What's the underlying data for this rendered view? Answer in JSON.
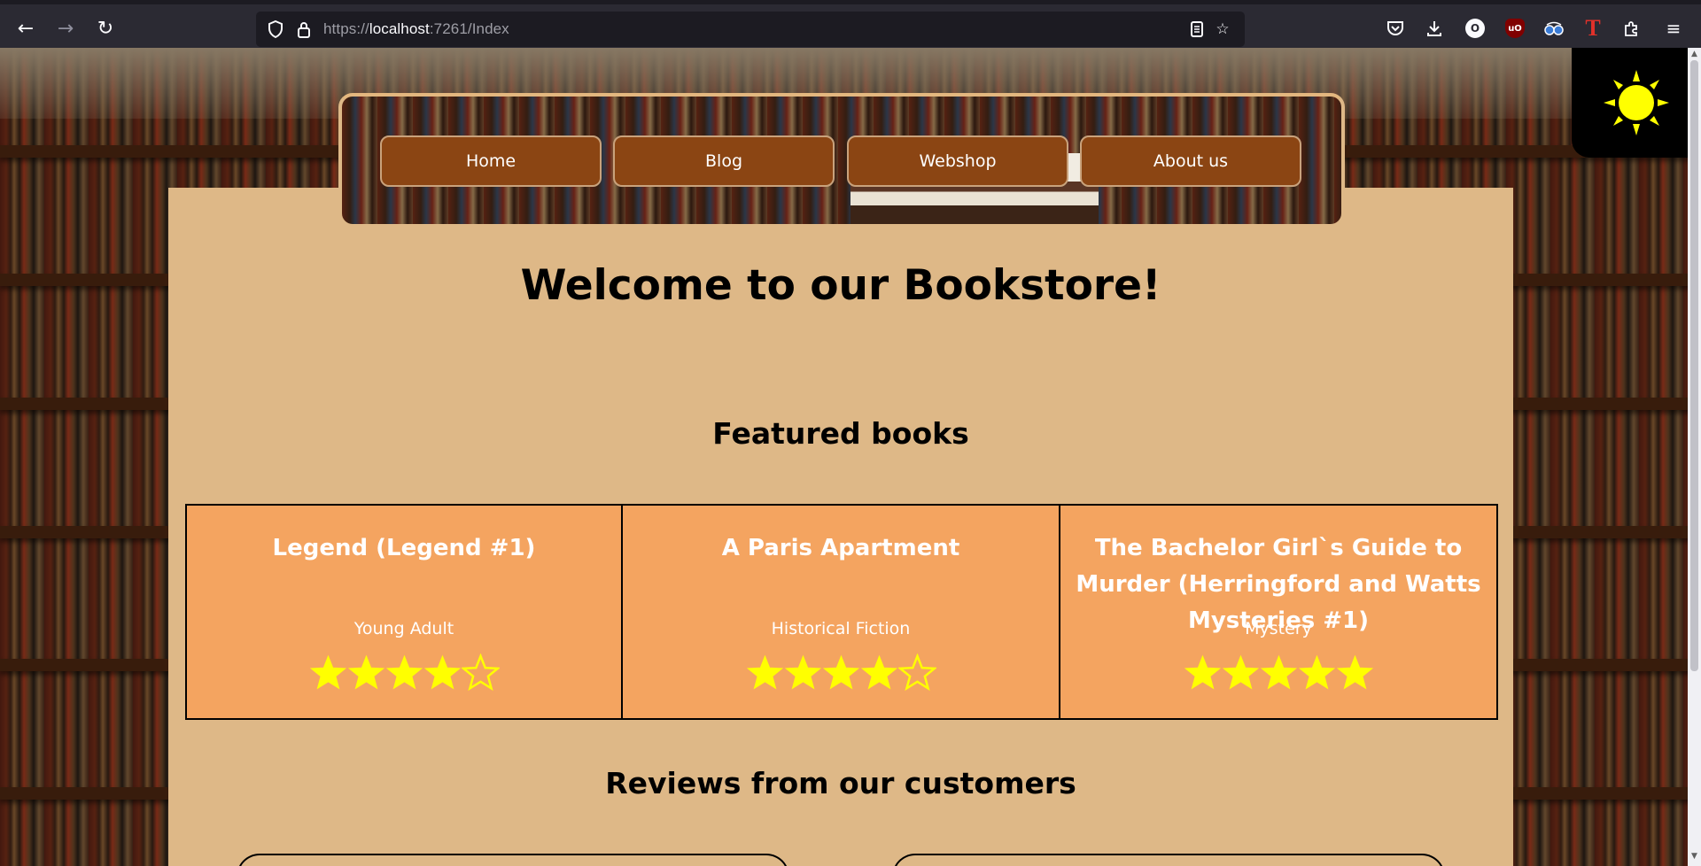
{
  "browser": {
    "url_scheme": "https://",
    "url_host": "localhost",
    "url_rest": ":7261/Index",
    "icons": [
      "back-icon",
      "forward-icon",
      "reload-icon",
      "shield-icon",
      "lock-icon",
      "reader-view-icon",
      "bookmark-star-icon",
      "pocket-icon",
      "download-icon",
      "extension-o-icon",
      "ublock-icon",
      "glasses-icon",
      "t-extension-icon",
      "extensions-puzzle-icon",
      "menu-icon"
    ]
  },
  "nav": {
    "items": [
      {
        "label": "Home"
      },
      {
        "label": "Blog"
      },
      {
        "label": "Webshop"
      },
      {
        "label": "About us"
      }
    ]
  },
  "theme_toggle": {
    "icon": "sun-icon",
    "color": "#ffff00"
  },
  "main": {
    "welcome_title": "Welcome to our Bookstore!",
    "featured_title": "Featured books",
    "reviews_title": "Reviews from our customers"
  },
  "featured_books": [
    {
      "title": "Legend (Legend #1)",
      "genre": "Young Adult",
      "rating": 4,
      "max_rating": 5
    },
    {
      "title": "A Paris Apartment",
      "genre": "Historical Fiction",
      "rating": 4,
      "max_rating": 5
    },
    {
      "title": "The Bachelor Girl`s Guide to Murder (Herringford and Watts Mysteries #1)",
      "genre": "Mystery",
      "rating": 5,
      "max_rating": 5
    }
  ],
  "colors": {
    "content_bg": "#deb887",
    "nav_button_bg": "#8b4513",
    "card_bg": "#f4a460",
    "star": "#ffff00"
  }
}
